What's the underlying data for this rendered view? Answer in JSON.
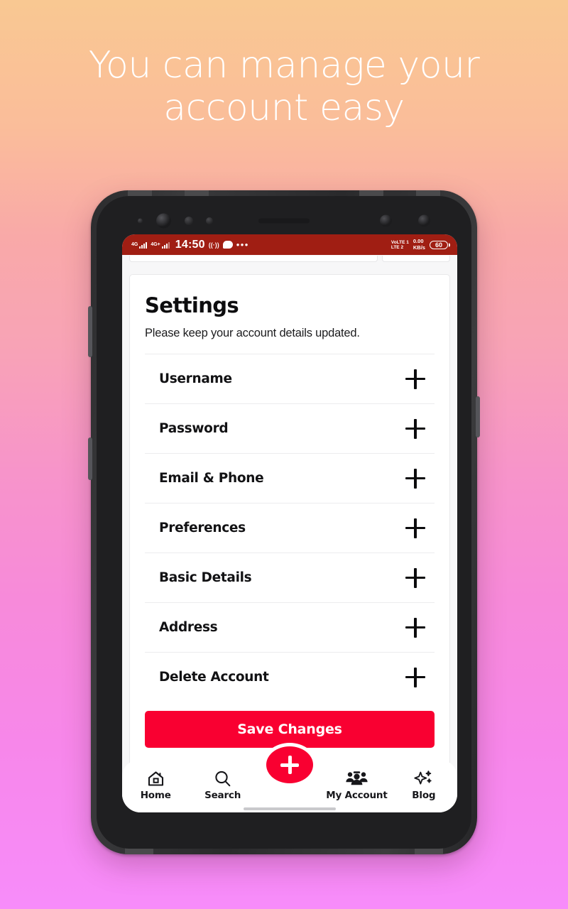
{
  "headline": {
    "line1": "You can manage your",
    "line2": "account easy"
  },
  "colors": {
    "bg_top": "#f9c892",
    "bg_bottom": "#f78cfa",
    "statusbar_red": "#a01e13",
    "accent_red": "#f90031",
    "text_dark": "#121214",
    "card_white": "#ffffff"
  },
  "statusbar": {
    "sim1_network": "4G",
    "sim2_network": "4G+",
    "time": "14:50",
    "cast_icon": "cast-icon",
    "chat_icon": "chat-bubble-icon",
    "more_icon": "more-dots-icon",
    "volte_line1": "VoLTE 1",
    "volte_line2": "LTE 2",
    "speed_value": "0.00",
    "speed_unit": "KB/s",
    "battery": "60"
  },
  "card": {
    "title": "Settings",
    "subtitle": "Please keep your account details updated.",
    "items": [
      {
        "label": "Username",
        "action_icon": "plus-icon"
      },
      {
        "label": "Password",
        "action_icon": "plus-icon"
      },
      {
        "label": "Email & Phone",
        "action_icon": "plus-icon"
      },
      {
        "label": "Preferences",
        "action_icon": "plus-icon"
      },
      {
        "label": "Basic Details",
        "action_icon": "plus-icon"
      },
      {
        "label": "Address",
        "action_icon": "plus-icon"
      },
      {
        "label": "Delete Account",
        "action_icon": "plus-icon"
      }
    ],
    "save_label": "Save Changes"
  },
  "bottomnav": {
    "items": [
      {
        "label": "Home",
        "icon": "home-icon"
      },
      {
        "label": "Search",
        "icon": "search-icon"
      },
      {
        "label": "",
        "icon": "plus-icon"
      },
      {
        "label": "My Account",
        "icon": "people-group-icon"
      },
      {
        "label": "Blog",
        "icon": "sparkles-icon"
      }
    ],
    "fab_icon": "plus-icon"
  }
}
